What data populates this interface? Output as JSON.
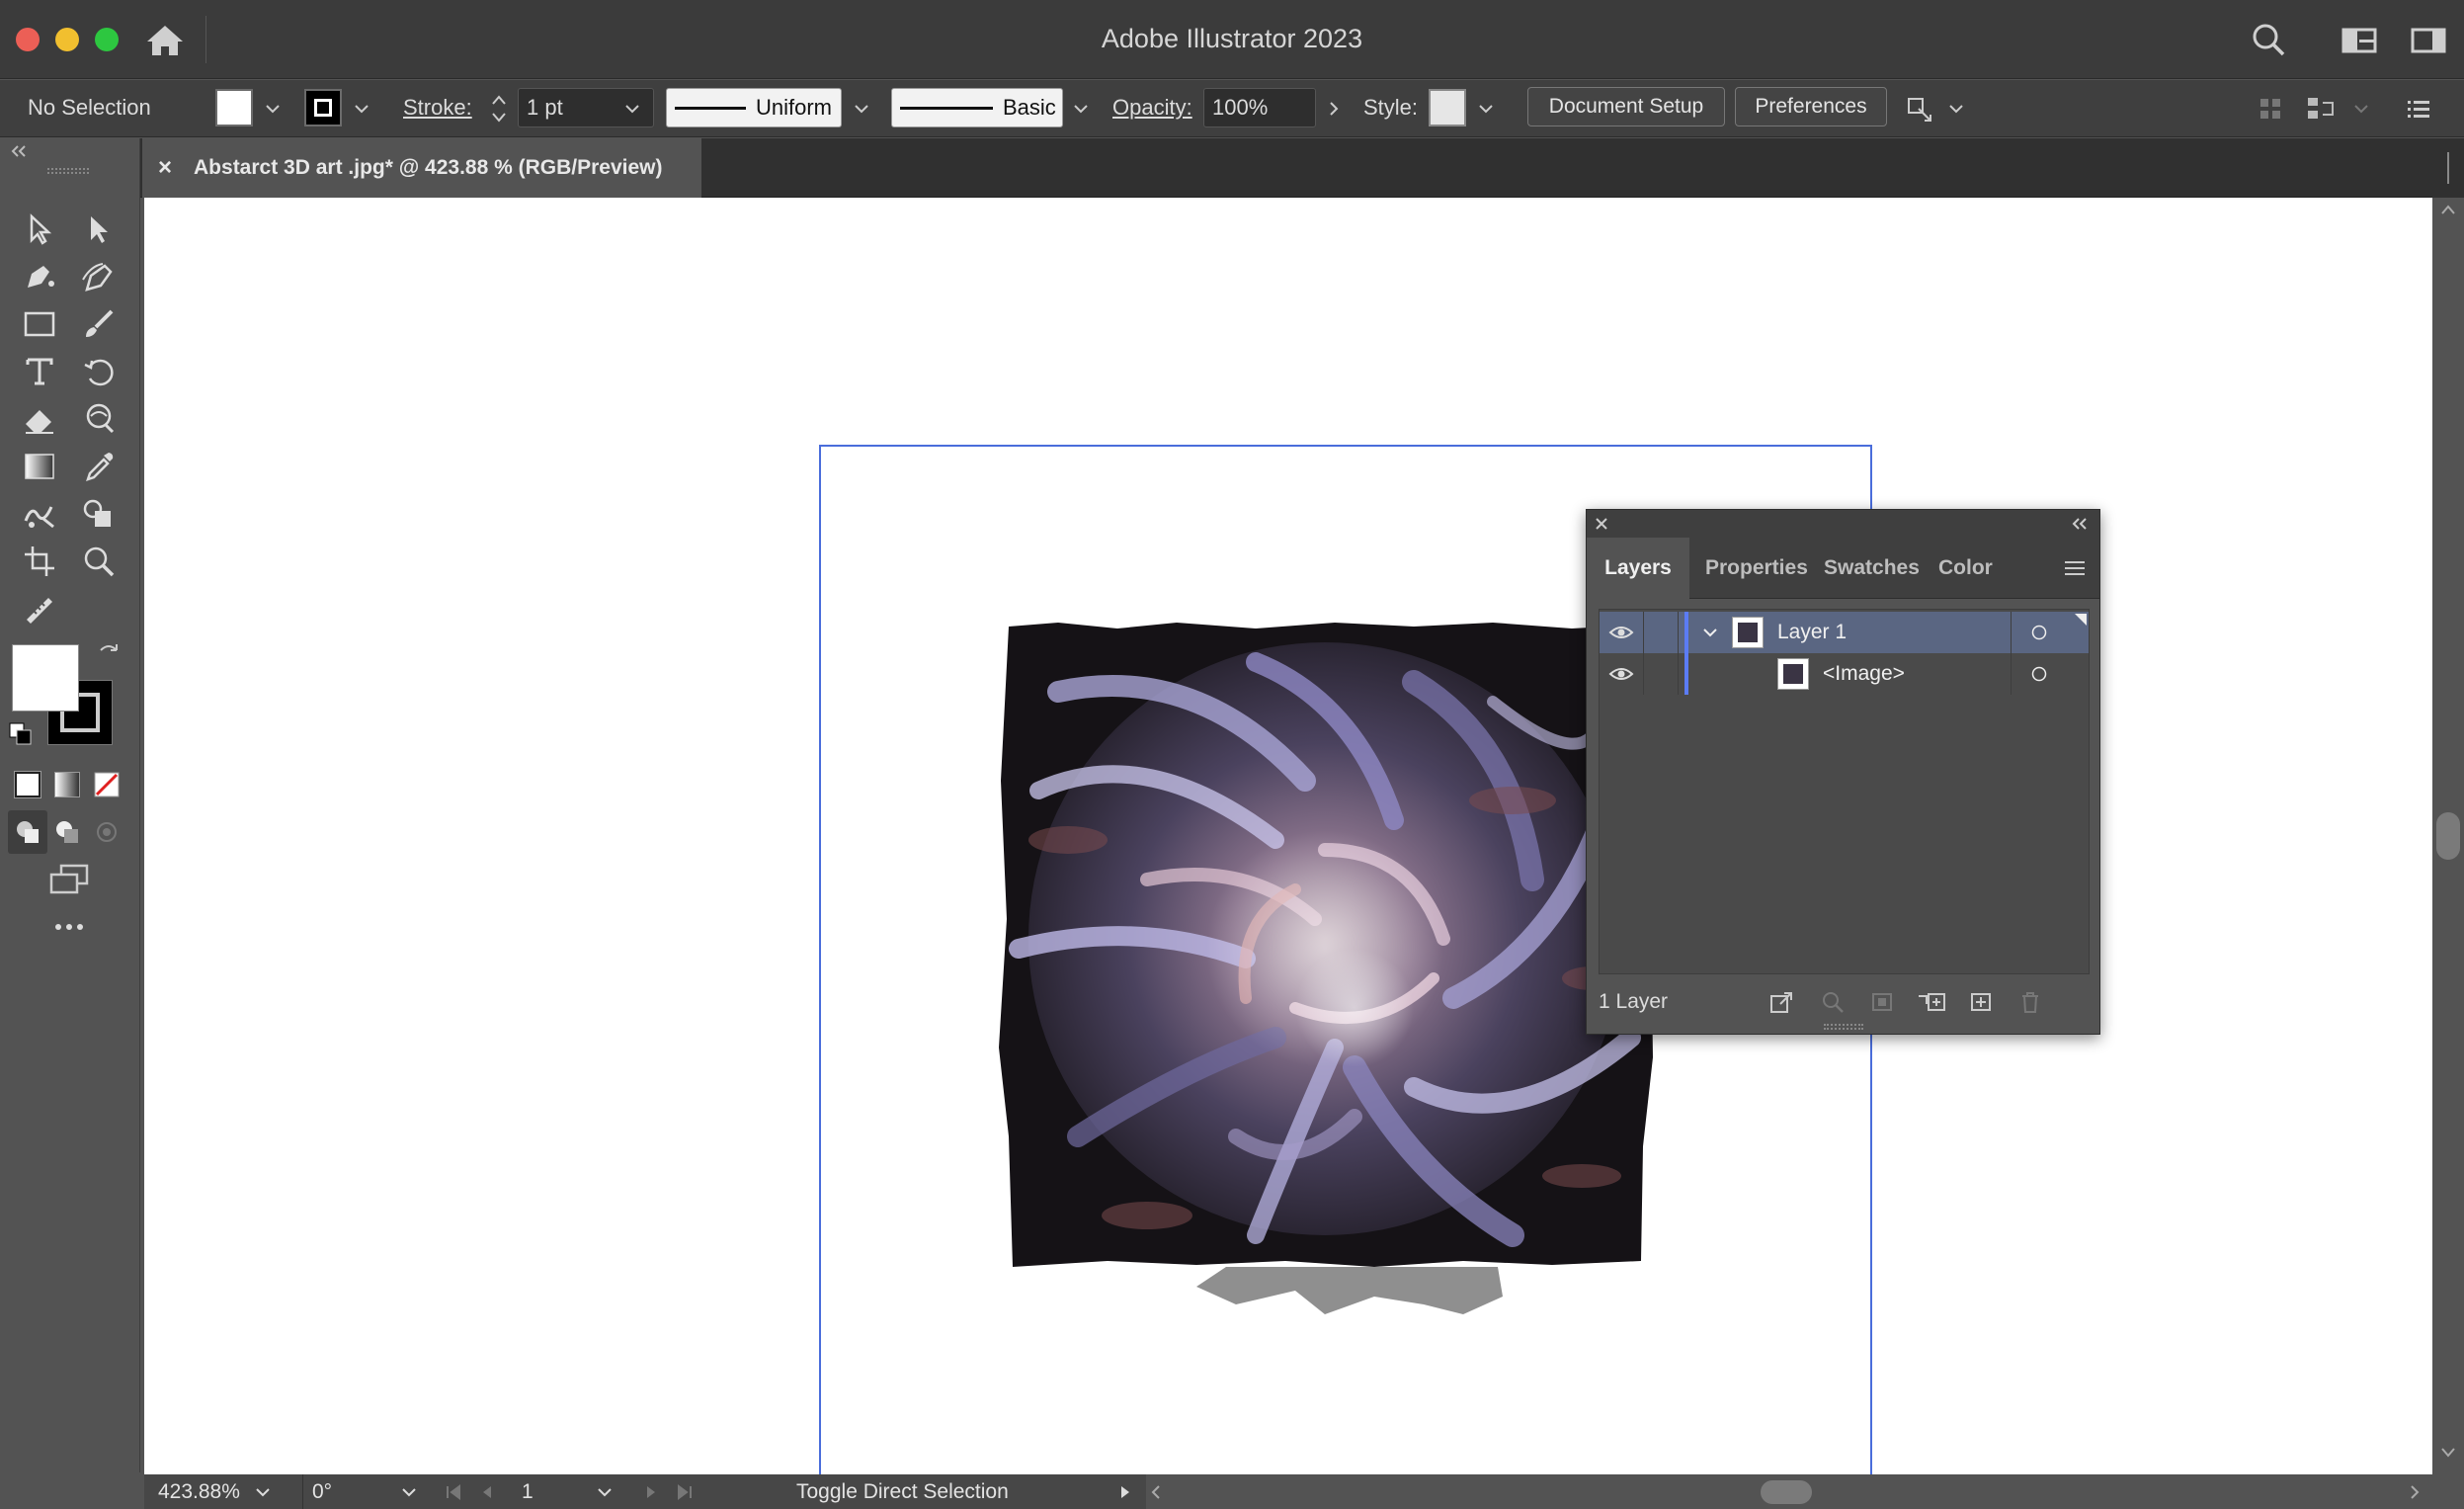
{
  "app": {
    "title": "Adobe Illustrator 2023"
  },
  "control_bar": {
    "selection": "No Selection",
    "stroke_label": "Stroke:",
    "stroke_weight": "1 pt",
    "profile": "Uniform",
    "brush": "Basic",
    "opacity_label": "Opacity:",
    "opacity_value": "100%",
    "style_label": "Style:",
    "document_setup": "Document Setup",
    "preferences": "Preferences"
  },
  "document_tab": {
    "close": "×",
    "label": "Abstarct 3D art .jpg* @ 423.88 % (RGB/Preview)"
  },
  "layers_panel": {
    "tabs": [
      "Layers",
      "Properties",
      "Swatches",
      "Color"
    ],
    "active_tab": "Layers",
    "rows": [
      {
        "name": "Layer 1",
        "expanded": true,
        "selected": true
      },
      {
        "name": "<Image>",
        "expanded": false,
        "selected": false
      }
    ],
    "footer_count": "1 Layer",
    "layer_color": "#5b7cf5"
  },
  "status_bar": {
    "zoom": "423.88%",
    "rotation": "0°",
    "artboard_number": "1",
    "status_text": "Toggle Direct Selection"
  },
  "colors": {
    "artboard_border": "#4a6ddb",
    "selected_row": "#5a6682"
  }
}
